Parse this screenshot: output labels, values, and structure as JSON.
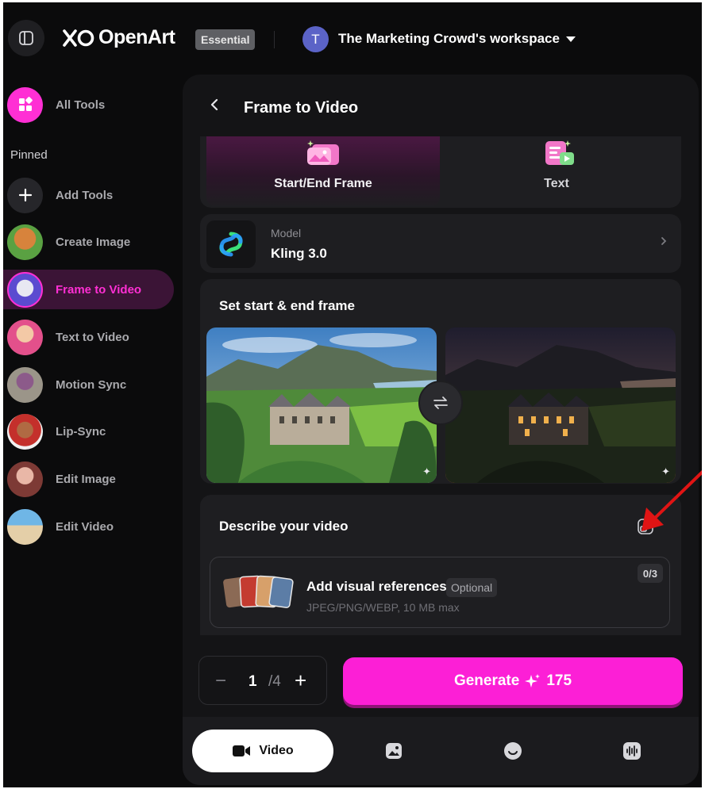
{
  "header": {
    "logo_text": "OpenArt",
    "plan_badge": "Essential",
    "workspace_initial": "T",
    "workspace_name": "The Marketing Crowd's workspace"
  },
  "sidebar": {
    "pinned_label": "Pinned",
    "items": [
      {
        "label": "All Tools",
        "icon": "grid-icon"
      },
      {
        "label": "Add Tools",
        "icon": "plus-icon"
      },
      {
        "label": "Create Image",
        "icon": "avatar-thumbnail"
      },
      {
        "label": "Frame to Video",
        "icon": "avatar-thumbnail",
        "active": true
      },
      {
        "label": "Text to Video",
        "icon": "avatar-thumbnail"
      },
      {
        "label": "Motion Sync",
        "icon": "avatar-thumbnail"
      },
      {
        "label": "Lip-Sync",
        "icon": "avatar-thumbnail"
      },
      {
        "label": "Edit Image",
        "icon": "avatar-thumbnail"
      },
      {
        "label": "Edit Video",
        "icon": "avatar-thumbnail"
      }
    ]
  },
  "panel": {
    "title": "Frame to Video",
    "modes": [
      {
        "label": "Start/End Frame",
        "active": true
      },
      {
        "label": "Text",
        "active": false
      }
    ],
    "model": {
      "caption": "Model",
      "value": "Kling 3.0"
    },
    "frames": {
      "title": "Set start & end frame"
    },
    "describe": {
      "title": "Describe your video",
      "refs_title": "Add visual references",
      "refs_optional": "Optional",
      "refs_sub": "JPEG/PNG/WEBP, 10 MB max",
      "refs_count": "0/3"
    },
    "stepper": {
      "value": "1",
      "total": "/4",
      "minus": "−",
      "plus": "+"
    },
    "generate": {
      "label": "Generate",
      "cost": "175"
    },
    "tabs": [
      {
        "label": "Video",
        "icon": "video-camera-icon",
        "active": true
      },
      {
        "icon": "image-icon"
      },
      {
        "icon": "face-icon"
      },
      {
        "icon": "audio-wave-icon"
      }
    ]
  },
  "colors": {
    "accent": "#fc1fd6",
    "background": "#0b0b0c",
    "panel": "#141416",
    "card": "#1e1e21"
  }
}
